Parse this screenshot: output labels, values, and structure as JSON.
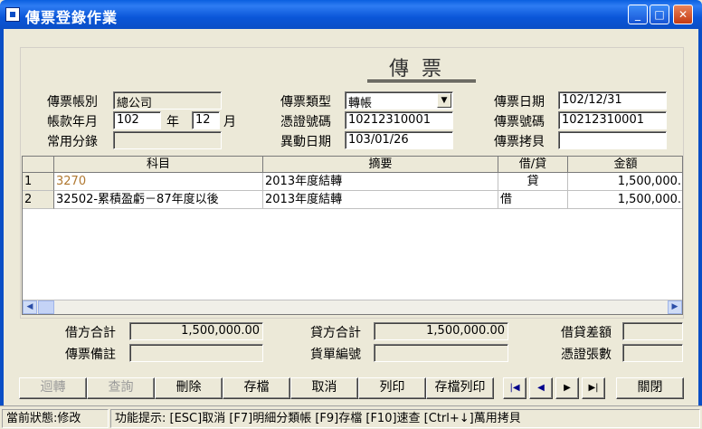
{
  "window": {
    "title": "傳票登錄作業",
    "minimize_glyph": "_",
    "maximize_glyph": "□",
    "close_glyph": "✕"
  },
  "heading": "傳票",
  "form": {
    "account_book_label": "傳票帳別",
    "account_book_value": "總公司",
    "year_month_label": "帳款年月",
    "year_value": "102",
    "year_unit": "年",
    "month_value": "12",
    "month_unit": "月",
    "common_entry_label": "常用分錄",
    "common_entry_value": "",
    "voucher_type_label": "傳票類型",
    "voucher_type_value": "轉帳",
    "evidence_no_label": "憑證號碼",
    "evidence_no_value": "10212310001",
    "change_date_label": "異動日期",
    "change_date_value": "103/01/26",
    "voucher_date_label": "傳票日期",
    "voucher_date_value": "102/12/31",
    "voucher_no_label": "傳票號碼",
    "voucher_no_value": "10212310001",
    "voucher_copy_label": "傳票拷貝",
    "voucher_copy_value": ""
  },
  "grid": {
    "columns": [
      "科目",
      "摘要",
      "借/貸",
      "金額"
    ],
    "rows": [
      {
        "num": "1",
        "subject": "3270",
        "summary": "2013年度結轉",
        "dc": "貸",
        "amount": "1,500,000."
      },
      {
        "num": "2",
        "subject": "32502-累積盈虧－87年度以後",
        "summary": "2013年度結轉",
        "dc": "借",
        "amount": "1,500,000."
      }
    ]
  },
  "totals": {
    "debit_total_label": "借方合計",
    "debit_total_value": "1,500,000.00",
    "credit_total_label": "貸方合計",
    "credit_total_value": "1,500,000.00",
    "difference_label": "借貸差額",
    "difference_value": "",
    "remark_label": "傳票備註",
    "remark_value": "",
    "bill_no_label": "貨單編號",
    "bill_no_value": "",
    "evidence_count_label": "憑證張數",
    "evidence_count_value": ""
  },
  "buttons": {
    "reverse": "迴轉",
    "query": "查詢",
    "delete": "刪除",
    "save": "存檔",
    "cancel": "取消",
    "print": "列印",
    "save_print": "存檔列印",
    "first": "|◀",
    "prev": "◀",
    "next": "▶",
    "last": "▶|",
    "close": "關閉"
  },
  "status": {
    "state": "當前狀態:修改",
    "hint": "功能提示: [ESC]取消 [F7]明細分類帳 [F9]存檔 [F10]速查 [Ctrl+↓]萬用拷貝"
  }
}
